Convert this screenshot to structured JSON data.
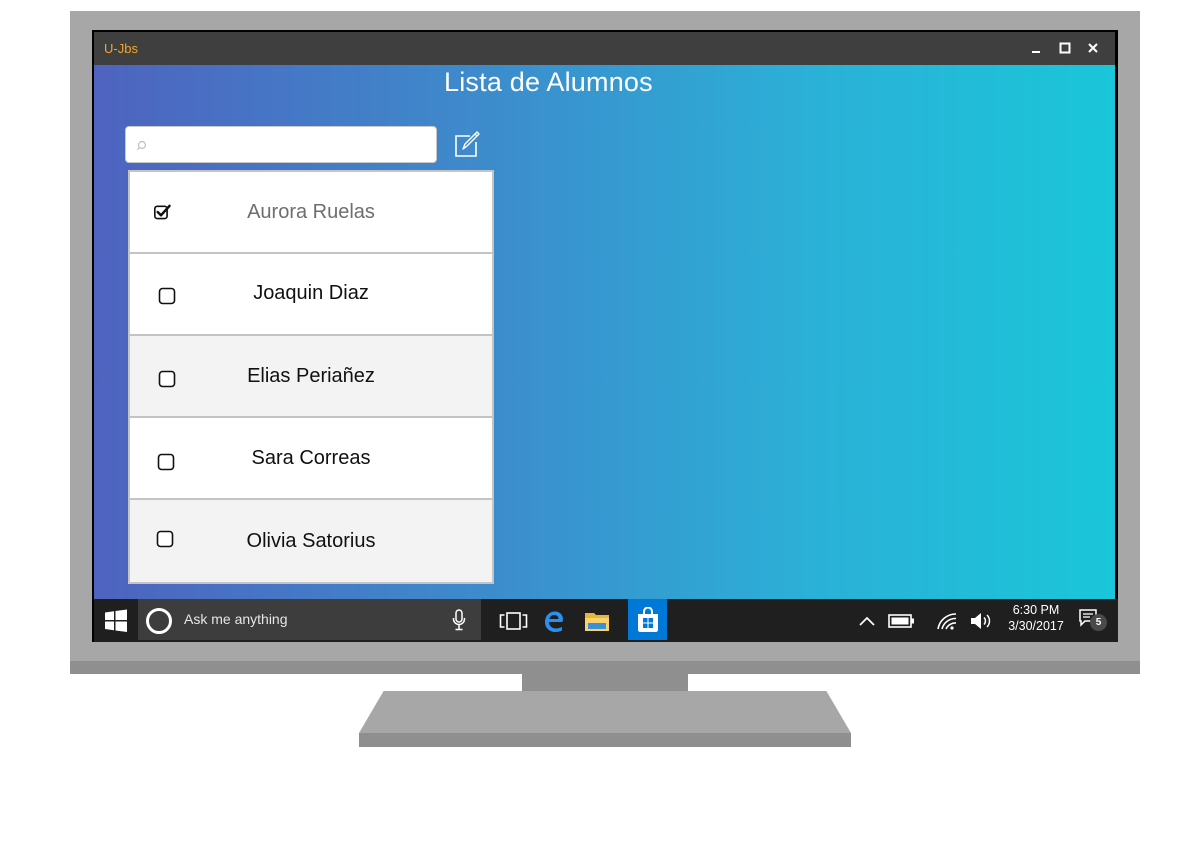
{
  "window": {
    "app_title": "U-Jbs"
  },
  "page": {
    "title": "Lista de Alumnos"
  },
  "search": {
    "value": "",
    "placeholder": ""
  },
  "students": [
    {
      "name": "Aurora Ruelas",
      "checked": true
    },
    {
      "name": "Joaquin Diaz",
      "checked": false
    },
    {
      "name": "Elias Periañez",
      "checked": false
    },
    {
      "name": "Sara  Correas",
      "checked": false
    },
    {
      "name": "Olivia Satorius",
      "checked": false
    }
  ],
  "taskbar": {
    "search_placeholder": "Ask me anything",
    "time": "6:30 PM",
    "date": "3/30/2017",
    "notification_count": "5",
    "pinned_icons": [
      "task-view-icon",
      "edge-browser-icon",
      "file-explorer-icon",
      "store-icon"
    ],
    "active_app": "store-icon"
  },
  "colors": {
    "accent_title": "#f5a623",
    "gradient_start": "#4e63bf",
    "gradient_end": "#1ac6d9",
    "taskbar": "#1f1f1f",
    "store_active": "#0078d7"
  }
}
